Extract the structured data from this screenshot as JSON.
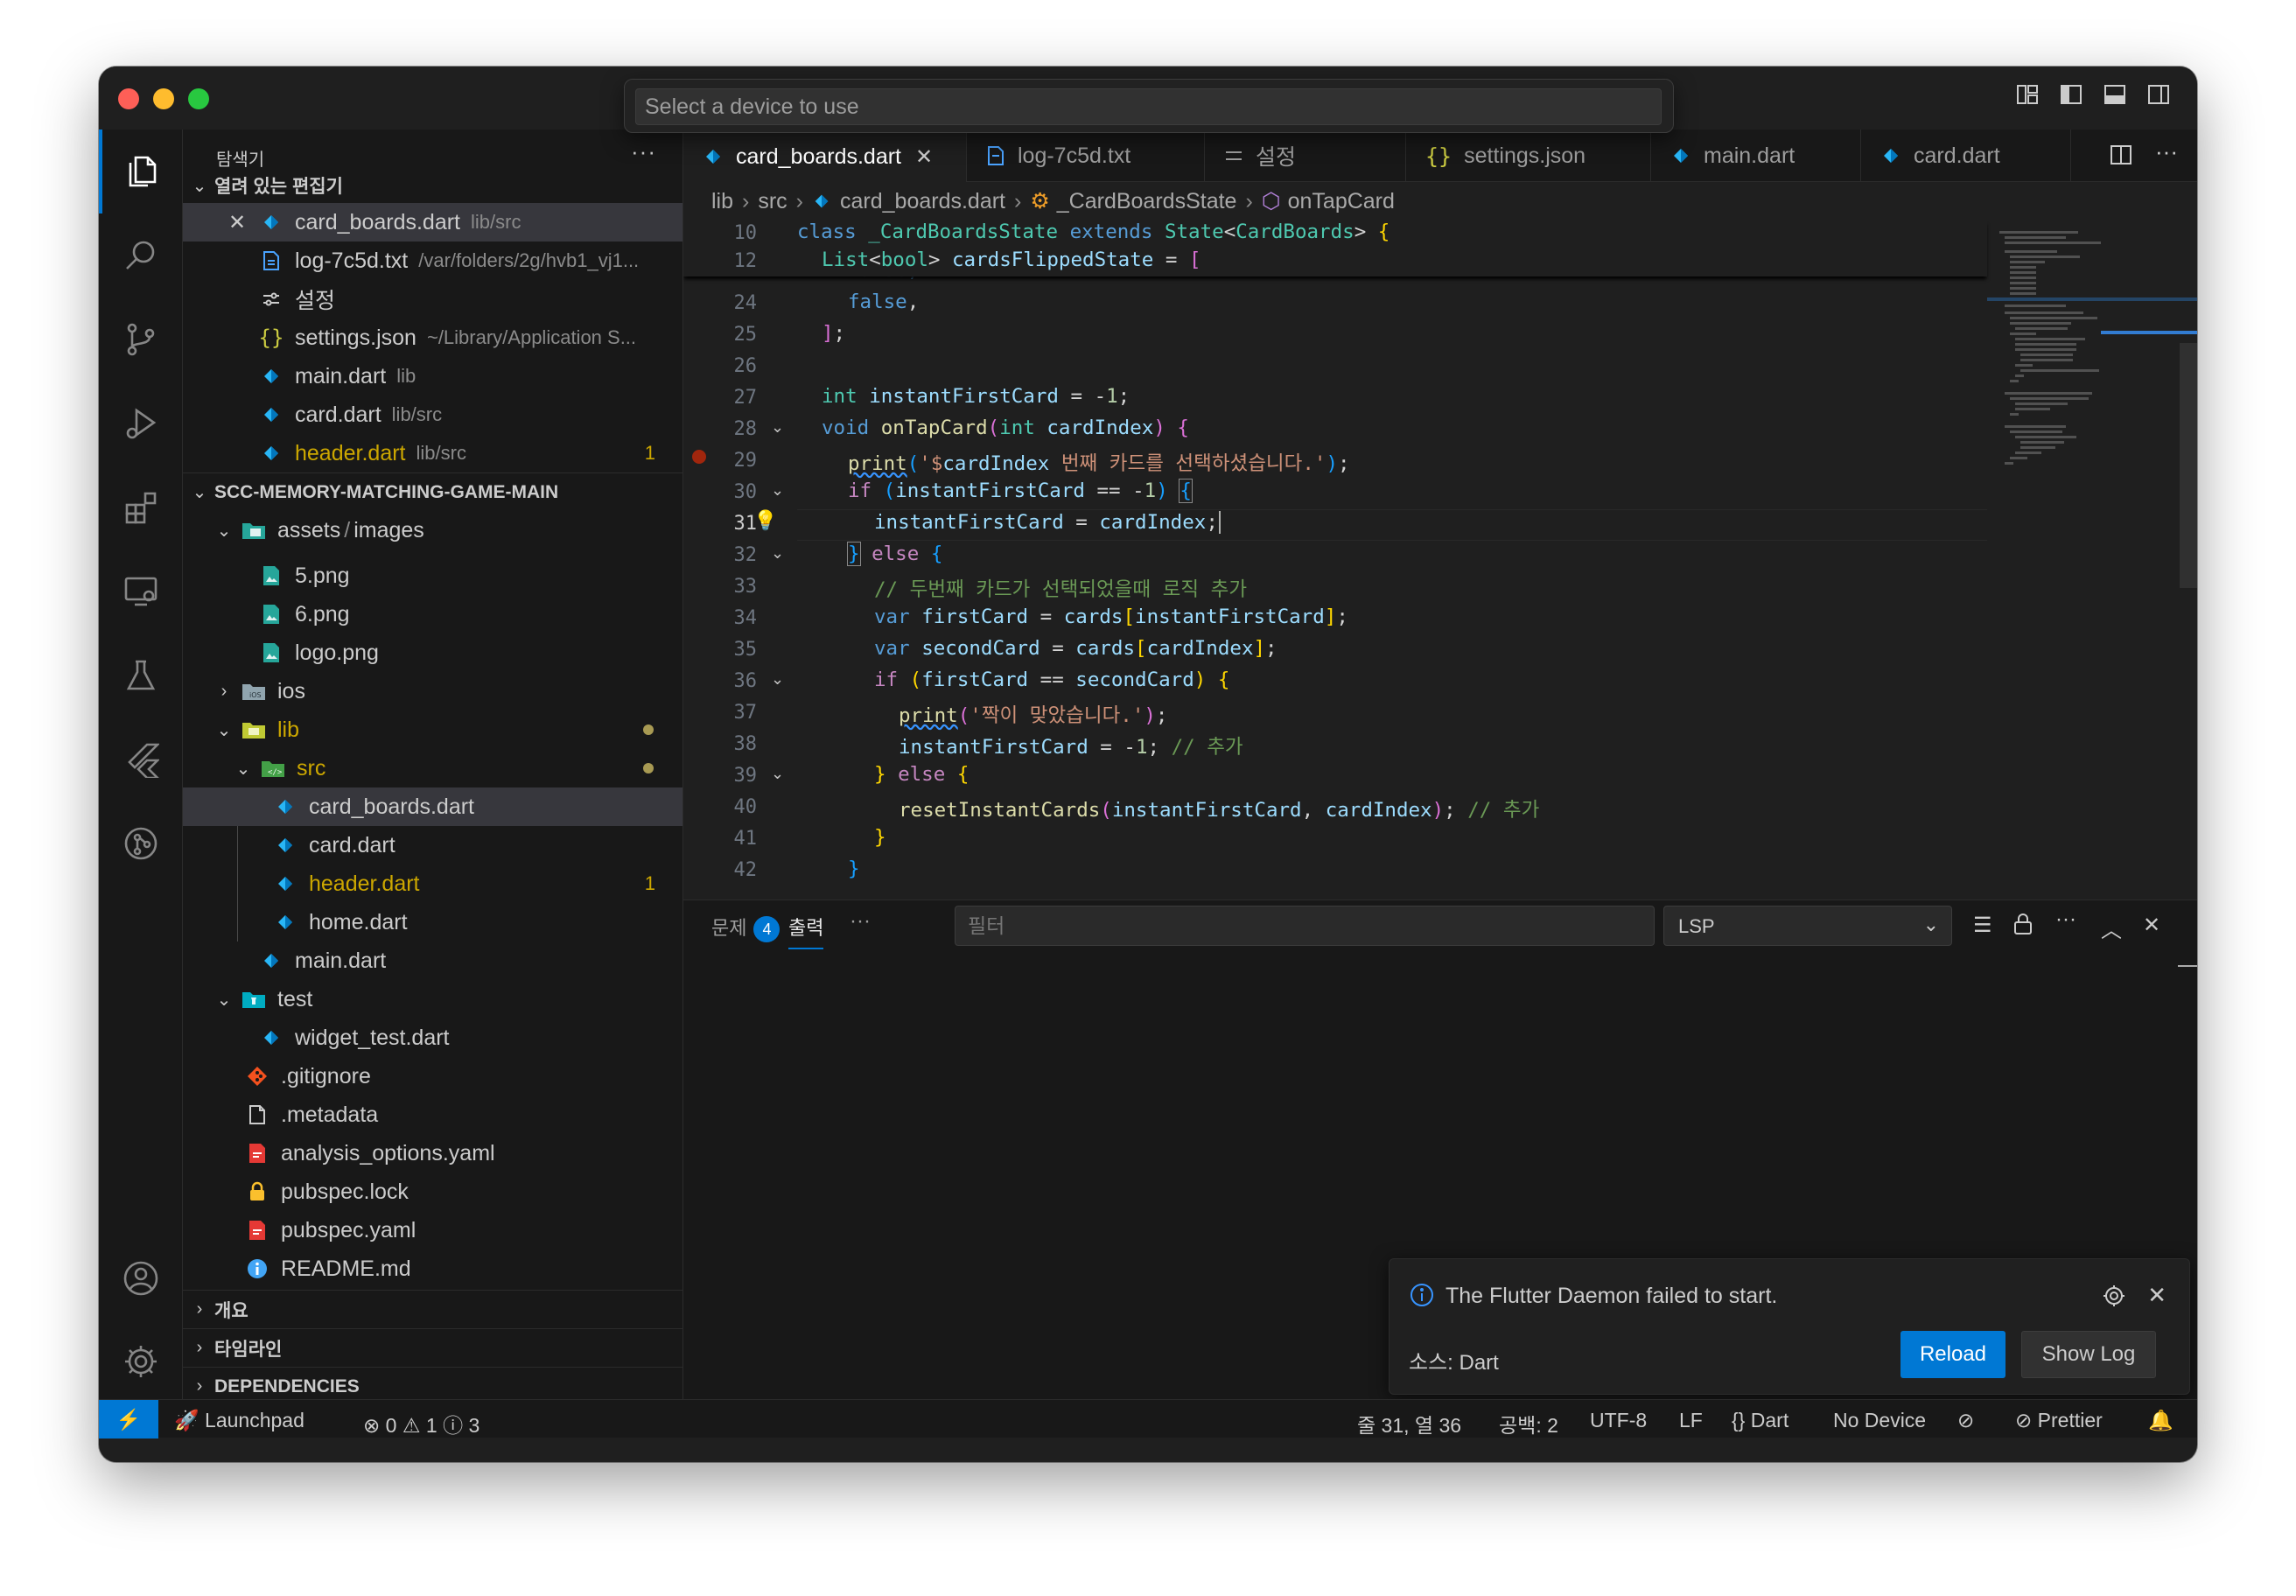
{
  "command_palette": {
    "placeholder": "Select a device to use"
  },
  "sidebar": {
    "title": "탐색기",
    "open_editors_title": "열려 있는 편집기",
    "open_editors": [
      {
        "name": "card_boards.dart",
        "desc": "lib/src"
      },
      {
        "name": "log-7c5d.txt",
        "desc": "/var/folders/2g/hvb1_vj1..."
      },
      {
        "name": "설정",
        "desc": ""
      },
      {
        "name": "settings.json",
        "desc": "~/Library/Application S..."
      },
      {
        "name": "main.dart",
        "desc": "lib"
      },
      {
        "name": "card.dart",
        "desc": "lib/src"
      },
      {
        "name": "header.dart",
        "desc": "lib/src",
        "badge": "1"
      }
    ],
    "project_title": "SCC-MEMORY-MATCHING-GAME-MAIN",
    "tree": [
      {
        "name": "assets",
        "sub": "images"
      },
      {
        "name": "5.png"
      },
      {
        "name": "6.png"
      },
      {
        "name": "logo.png"
      },
      {
        "name": "ios"
      },
      {
        "name": "lib"
      },
      {
        "name": "src"
      },
      {
        "name": "card_boards.dart"
      },
      {
        "name": "card.dart"
      },
      {
        "name": "header.dart",
        "badge": "1"
      },
      {
        "name": "home.dart"
      },
      {
        "name": "main.dart"
      },
      {
        "name": "test"
      },
      {
        "name": "widget_test.dart"
      },
      {
        "name": ".gitignore"
      },
      {
        "name": ".metadata"
      },
      {
        "name": "analysis_options.yaml"
      },
      {
        "name": "pubspec.lock"
      },
      {
        "name": "pubspec.yaml"
      },
      {
        "name": "README.md"
      }
    ],
    "outline_title": "개요",
    "timeline_title": "타임라인",
    "dependencies_title": "DEPENDENCIES"
  },
  "tabs": [
    {
      "label": "card_boards.dart",
      "active": true
    },
    {
      "label": "log-7c5d.txt"
    },
    {
      "label": "설정"
    },
    {
      "label": "settings.json"
    },
    {
      "label": "main.dart"
    },
    {
      "label": "card.dart"
    }
  ],
  "breadcrumbs": [
    "lib",
    "src",
    "card_boards.dart",
    "_CardBoardsState",
    "onTapCard"
  ],
  "editor": {
    "sticky_lines": [
      "10",
      "12"
    ],
    "line_numbers": [
      "24",
      "25",
      "26",
      "27",
      "28",
      "29",
      "30",
      "31",
      "32",
      "33",
      "34",
      "35",
      "36",
      "37",
      "38",
      "39",
      "40",
      "41",
      "42"
    ],
    "current_line": "31"
  },
  "panel": {
    "tabs": [
      {
        "label": "문제",
        "badge": "4"
      },
      {
        "label": "출력"
      }
    ],
    "more": "···",
    "filter_placeholder": "필터",
    "channel": "LSP"
  },
  "notification": {
    "message": "The Flutter Daemon failed to start.",
    "source": "소스: Dart",
    "reload_label": "Reload",
    "show_log_label": "Show Log"
  },
  "status_bar": {
    "launchpad": "Launchpad",
    "errors": "0",
    "warnings": "1",
    "infos": "3",
    "position": "줄 31, 열 36",
    "spaces": "공백: 2",
    "encoding": "UTF-8",
    "eol": "LF",
    "language": "Dart",
    "device": "No Device",
    "prettier": "Prettier"
  },
  "colors": {
    "accent": "#0078d4",
    "background": "#1f1f1f",
    "sidebar": "#181818",
    "warning": "#cca700"
  }
}
